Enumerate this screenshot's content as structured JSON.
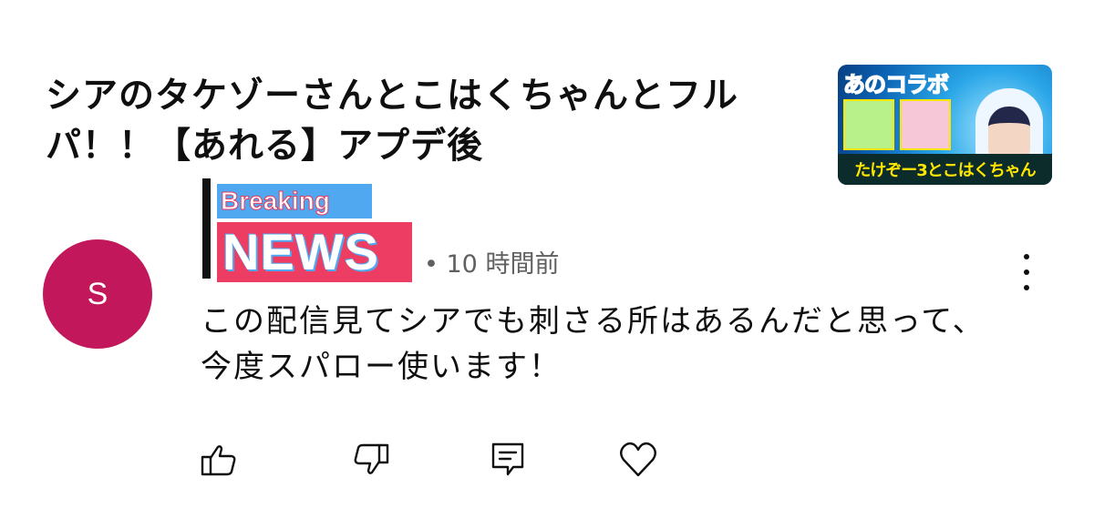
{
  "video": {
    "title": "シアのタケゾーさんとこはくちゃんとフルパ！！【あれる】アプデ後",
    "thumbnail": {
      "top_text": "あのコラボ",
      "bottom_text": "たけぞー3とこはくちゃん"
    }
  },
  "overlay": {
    "breaking": "Breaking",
    "news": "NEWS"
  },
  "comment": {
    "avatar_letter": "S",
    "time": "• 10 時間前",
    "text": "この配信見てシアでも刺さる所はあるんだと思って、今度スパロー使います！"
  },
  "icons": {
    "more": "more-vert-icon",
    "like": "thumbs-up-icon",
    "dislike": "thumbs-down-icon",
    "reply": "reply-icon",
    "heart": "heart-icon"
  },
  "colors": {
    "avatar": "#c2185b",
    "news_red": "#ee3d62",
    "breaking_blue": "#4fa8f0"
  }
}
